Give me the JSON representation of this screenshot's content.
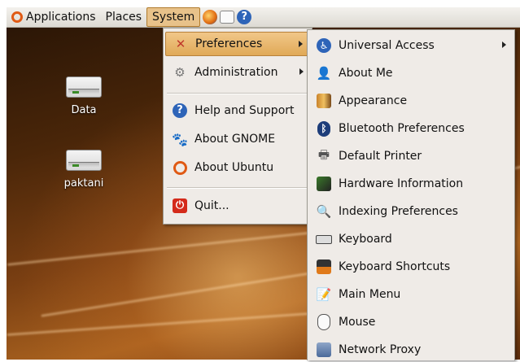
{
  "panel": {
    "menus": [
      {
        "label": "Applications",
        "icon": "ubuntu-logo-icon"
      },
      {
        "label": "Places"
      },
      {
        "label": "System"
      }
    ],
    "launchers": [
      "firefox-icon",
      "mail-icon",
      "help-icon"
    ]
  },
  "desktop": {
    "icons": [
      {
        "label": "Data",
        "icon": "drive-icon"
      },
      {
        "label": "paktani",
        "icon": "drive-icon"
      }
    ]
  },
  "system_menu": {
    "items": [
      {
        "label": "Preferences",
        "icon": "preferences-icon",
        "submenu": true,
        "highlighted": true
      },
      {
        "label": "Administration",
        "icon": "administration-icon",
        "submenu": true
      },
      {
        "label": "Help and Support",
        "icon": "help-icon"
      },
      {
        "label": "About GNOME",
        "icon": "gnome-foot-icon"
      },
      {
        "label": "About Ubuntu",
        "icon": "ubuntu-logo-icon"
      },
      {
        "label": "Quit...",
        "icon": "power-icon"
      }
    ]
  },
  "preferences_menu": {
    "items": [
      {
        "label": "Universal Access",
        "icon": "accessibility-icon",
        "submenu": true
      },
      {
        "label": "About Me",
        "icon": "about-me-icon"
      },
      {
        "label": "Appearance",
        "icon": "appearance-icon"
      },
      {
        "label": "Bluetooth Preferences",
        "icon": "bluetooth-icon"
      },
      {
        "label": "Default Printer",
        "icon": "printer-icon"
      },
      {
        "label": "Hardware Information",
        "icon": "hardware-icon"
      },
      {
        "label": "Indexing Preferences",
        "icon": "indexing-icon"
      },
      {
        "label": "Keyboard",
        "icon": "keyboard-icon"
      },
      {
        "label": "Keyboard Shortcuts",
        "icon": "keyboard-shortcuts-icon"
      },
      {
        "label": "Main Menu",
        "icon": "main-menu-icon"
      },
      {
        "label": "Mouse",
        "icon": "mouse-icon"
      },
      {
        "label": "Network Proxy",
        "icon": "network-proxy-icon"
      }
    ]
  },
  "colors": {
    "highlight": "#e8b46a",
    "menu_bg": "#efebe7",
    "ubuntu_orange": "#e05a14"
  }
}
